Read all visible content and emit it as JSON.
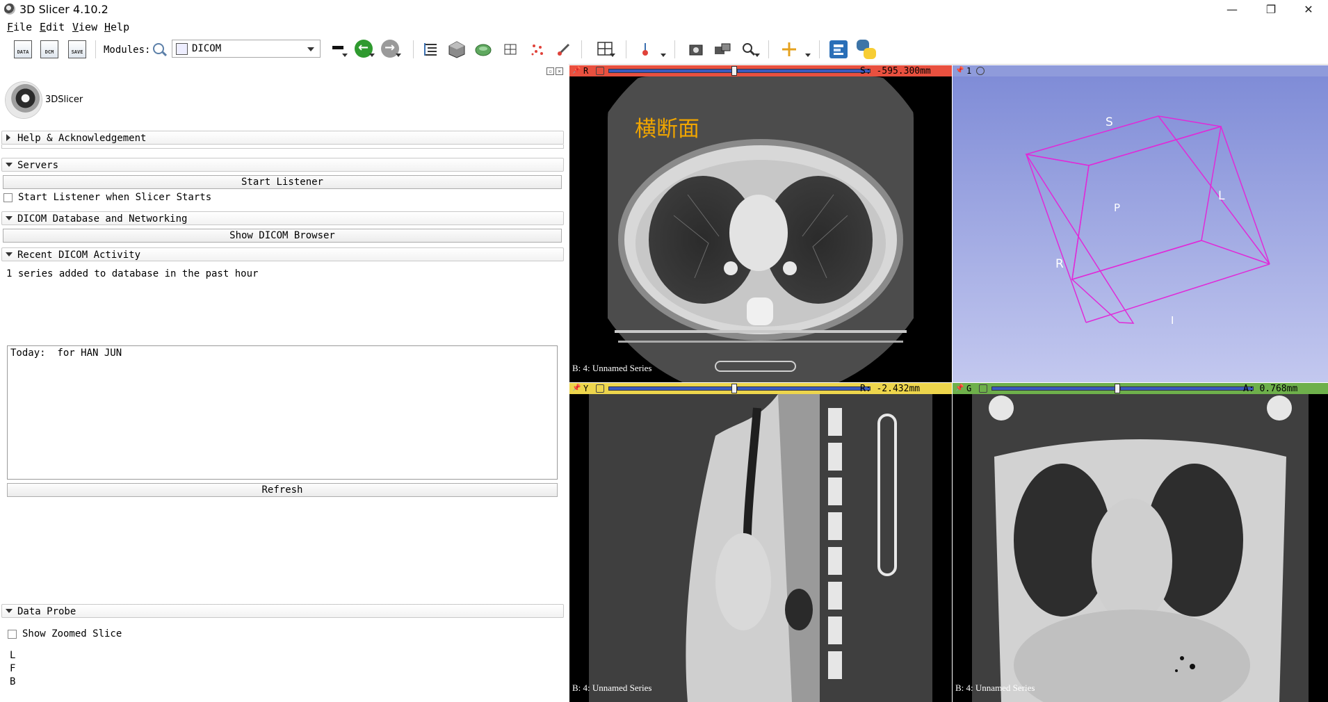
{
  "window": {
    "title": "3D Slicer 4.10.2",
    "minimize": "—",
    "restore": "❐",
    "close": "✕"
  },
  "menu": {
    "file": {
      "key": "F",
      "rest": "ile"
    },
    "edit": {
      "key": "E",
      "rest": "dit"
    },
    "view": {
      "key": "V",
      "rest": "iew"
    },
    "help": {
      "key": "H",
      "rest": "elp"
    }
  },
  "toolbar": {
    "data_label": "DATA",
    "dcm_label": "DCM",
    "save_label": "SAVE",
    "modules_label": "Modules:",
    "module_selected": "DICOM"
  },
  "left": {
    "logo_text": "3DSlicer",
    "help_section": "Help & Acknowledgement",
    "servers_section": "Servers",
    "start_listener": "Start Listener",
    "start_listener_check": "Start Listener when Slicer Starts",
    "dicom_db_section": "DICOM Database and Networking",
    "show_browser": "Show DICOM Browser",
    "recent_section": "Recent DICOM Activity",
    "recent_summary": "1 series added to database in the past hour",
    "recent_log": "Today:  for HAN JUN",
    "refresh": "Refresh",
    "probe_section": "Data Probe",
    "show_zoomed": "Show Zoomed Slice",
    "probe_l": "L",
    "probe_f": "F",
    "probe_b": "B"
  },
  "views": {
    "red": {
      "letter": "R",
      "readout": "S: -595.300mm",
      "series": "B: 4: Unnamed Series",
      "overlay_cn": "横断面",
      "color": "#e9503f",
      "slider_fraction": 0.5
    },
    "threeD": {
      "letter": "1",
      "color": "#8f9bdb",
      "S": "S",
      "P": "P",
      "L": "L",
      "R": "R",
      "I": "I"
    },
    "yellow": {
      "letter": "Y",
      "readout": "R: -2.432mm",
      "series": "B: 4: Unnamed Series",
      "color": "#edd54c",
      "slider_fraction": 0.5
    },
    "green": {
      "letter": "G",
      "readout": "A: 0.768mm",
      "series": "B: 4: Unnamed Series",
      "color": "#6eb04b",
      "slider_fraction": 0.5
    }
  }
}
